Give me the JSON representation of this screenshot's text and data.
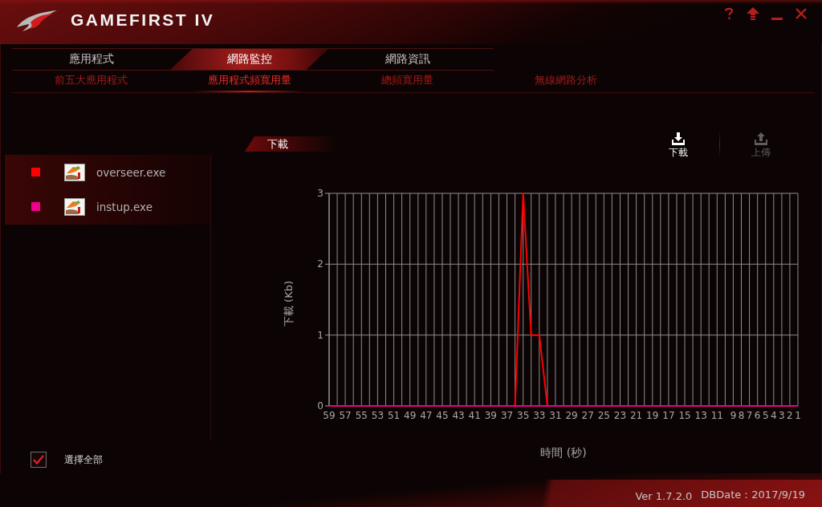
{
  "window": {
    "title": "GAMEFIRST IV"
  },
  "tabs": [
    {
      "label": "應用程式",
      "selected": false
    },
    {
      "label": "網路監控",
      "selected": true
    },
    {
      "label": "網路資訊",
      "selected": false
    }
  ],
  "subtabs": [
    {
      "label": "前五大應用程式",
      "selected": false
    },
    {
      "label": "應用程式頻寬用量",
      "selected": true
    },
    {
      "label": "總頻寬用量",
      "selected": false
    },
    {
      "label": "無線網路分析",
      "selected": false
    }
  ],
  "applications": [
    {
      "name": "overseer.exe",
      "color": "#ff0000"
    },
    {
      "name": "instup.exe",
      "color": "#ec008c"
    }
  ],
  "select_all": {
    "label": "選擇全部",
    "checked": true
  },
  "chart_panel": {
    "title": "下載",
    "modes": [
      {
        "kind": "download",
        "label": "下載",
        "selected": true
      },
      {
        "kind": "upload",
        "label": "上傳",
        "selected": false
      }
    ],
    "chart_data": {
      "type": "line",
      "xlabel": "時間 (秒)",
      "ylabel": "下載 (Kb)",
      "x": [
        59,
        58,
        57,
        56,
        55,
        54,
        53,
        52,
        51,
        50,
        49,
        48,
        47,
        46,
        45,
        44,
        43,
        42,
        41,
        40,
        39,
        38,
        37,
        36,
        35,
        34,
        33,
        32,
        31,
        30,
        29,
        28,
        27,
        26,
        25,
        24,
        23,
        22,
        21,
        20,
        19,
        18,
        17,
        16,
        15,
        14,
        13,
        12,
        11,
        10,
        9,
        8,
        7,
        6,
        5,
        4,
        3,
        2,
        1
      ],
      "series": [
        {
          "color": "#ff0000",
          "values": [
            null,
            null,
            null,
            null,
            null,
            null,
            null,
            null,
            null,
            null,
            null,
            null,
            null,
            null,
            null,
            null,
            null,
            null,
            null,
            null,
            null,
            null,
            null,
            0,
            3,
            1,
            1,
            0,
            null,
            null,
            null,
            null,
            null,
            null,
            null,
            null,
            null,
            null,
            null,
            null,
            null,
            null,
            null,
            null,
            null,
            null,
            null,
            null,
            null,
            null,
            null,
            null,
            null,
            null,
            null,
            null,
            null,
            null,
            null
          ]
        },
        {
          "color": "#ec008c",
          "values": [
            0,
            0,
            0,
            0,
            0,
            0,
            0,
            0,
            0,
            0,
            0,
            0,
            0,
            0,
            0,
            0,
            0,
            0,
            0,
            0,
            0,
            0,
            0,
            0,
            0,
            0,
            0,
            0,
            0,
            0,
            0,
            0,
            0,
            0,
            0,
            0,
            0,
            0,
            0,
            0,
            0,
            0,
            0,
            0,
            0,
            0,
            0,
            0,
            0,
            0,
            0,
            0,
            0,
            0,
            0,
            0,
            0,
            0,
            0
          ]
        }
      ],
      "xlim": [
        59,
        1
      ],
      "ylim": [
        0,
        3
      ],
      "xticks": [
        59,
        57,
        55,
        53,
        51,
        49,
        47,
        45,
        43,
        41,
        39,
        37,
        35,
        33,
        31,
        29,
        27,
        25,
        23,
        21,
        19,
        17,
        15,
        13,
        11,
        9,
        8,
        7,
        6,
        5,
        4,
        3,
        2,
        1
      ],
      "yticks": [
        0,
        1,
        2,
        3
      ],
      "grid": true
    }
  },
  "status_bar": {
    "version": "Ver 1.7.2.0",
    "db_date": "DBDate：2017/9/19"
  }
}
